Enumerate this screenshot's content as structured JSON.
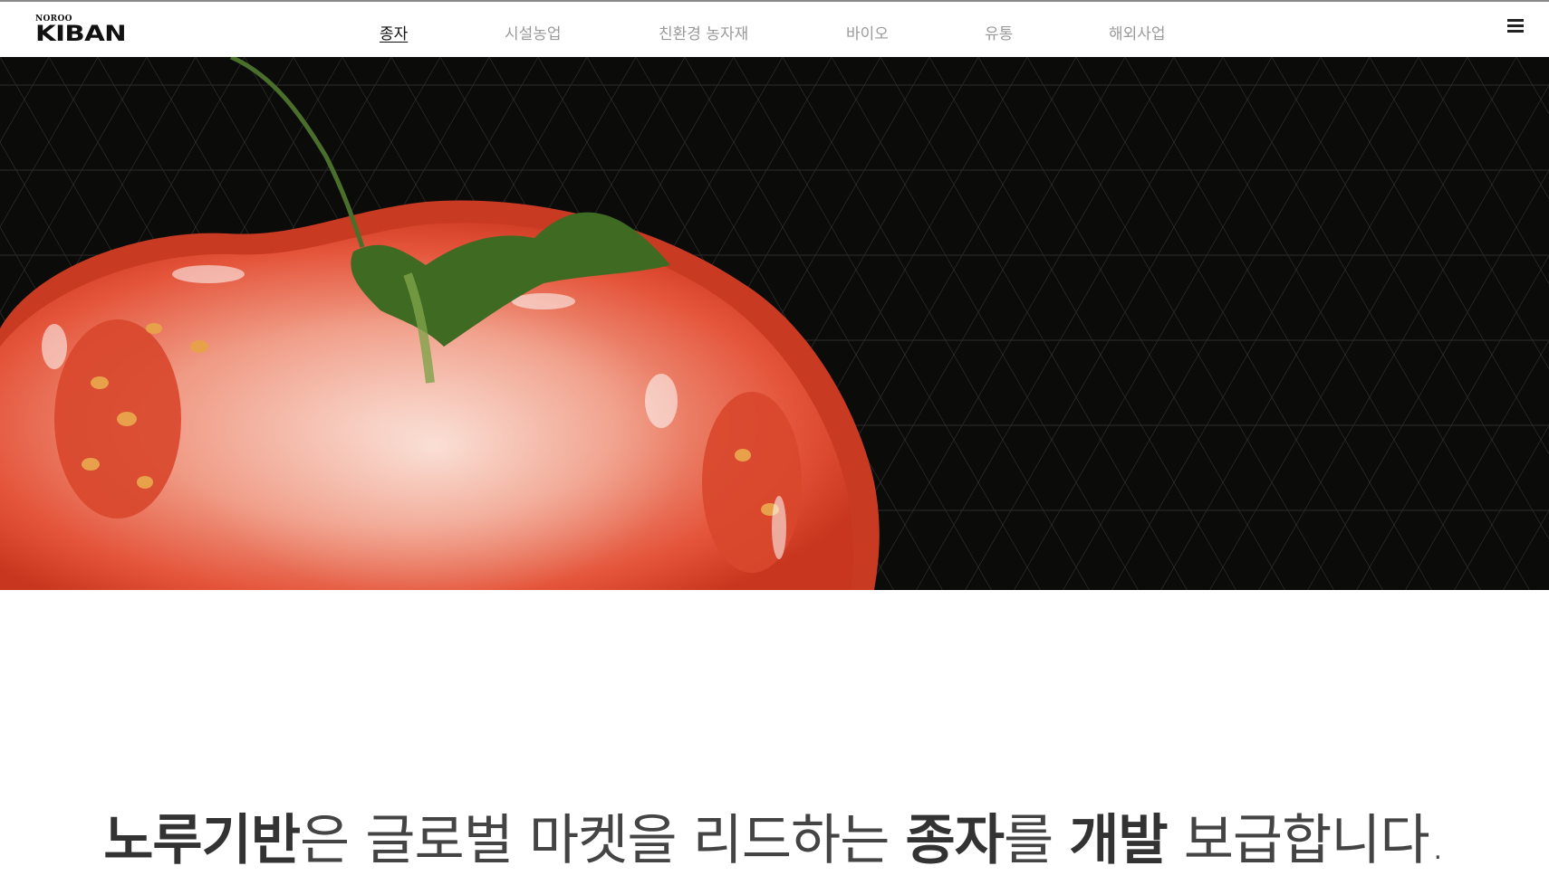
{
  "header": {
    "logo_top": "NOROO",
    "logo_main": "KIBAN",
    "nav": [
      {
        "label": "종자",
        "active": true
      },
      {
        "label": "시설농업",
        "active": false
      },
      {
        "label": "친환경 농자재",
        "active": false
      },
      {
        "label": "바이오",
        "active": false
      },
      {
        "label": "유통",
        "active": false
      },
      {
        "label": "해외사업",
        "active": false
      }
    ],
    "menu_icon": "hamburger-menu-icon"
  },
  "hero": {
    "image_subject": "halved tomato on black patterned background",
    "colors": {
      "background": "#0b0b0a",
      "tomato_flesh": "#e85a3e",
      "tomato_core": "#f4b7a6",
      "stem": "#3f6a22"
    }
  },
  "tagline": {
    "parts": [
      {
        "text": "노루기반",
        "weight": "bold"
      },
      {
        "text": "은 글로벌 마켓을 리드하는 ",
        "weight": "light"
      },
      {
        "text": "종자",
        "weight": "bold"
      },
      {
        "text": "를 ",
        "weight": "light"
      },
      {
        "text": "개발",
        "weight": "bold"
      },
      {
        "text": " 보급합니다.",
        "weight": "light"
      }
    ]
  }
}
